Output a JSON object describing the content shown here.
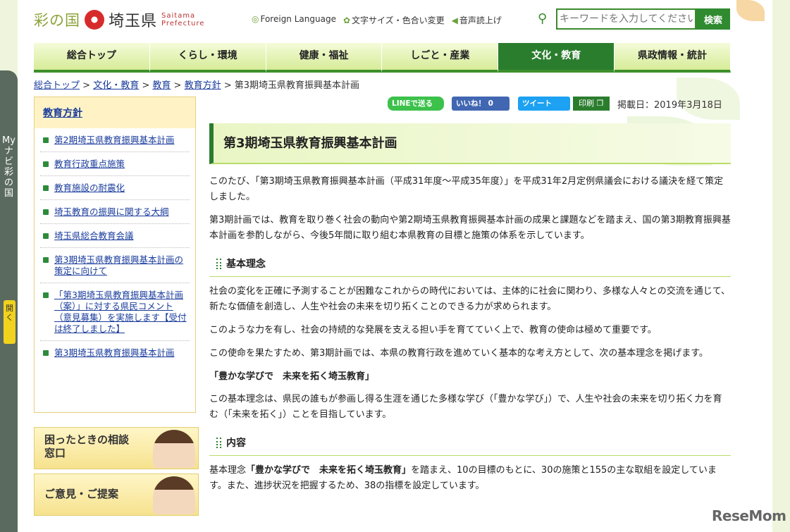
{
  "header": {
    "logo_saitama_no_kuni": "彩の国",
    "logo_pref": "埼玉県",
    "logo_en": "Saitama Prefecture",
    "util_links": [
      "Foreign Language",
      "文字サイズ・色合い変更",
      "音声読上げ"
    ],
    "search_placeholder": "キーワードを入力してください",
    "search_button": "検索"
  },
  "nav": {
    "items": [
      "総合トップ",
      "くらし・環境",
      "健康・福祉",
      "しごと・産業",
      "文化・教育",
      "県政情報・統計"
    ],
    "active": "文化・教育"
  },
  "side_tab": {
    "label": "Myナビ 彩の国",
    "open": "開く"
  },
  "breadcrumb": [
    "総合トップ",
    "文化・教育",
    "教育",
    "教育方針"
  ],
  "breadcrumb_current": "第3期埼玉県教育振興基本計画",
  "sidebar": {
    "heading": "教育方針",
    "items": [
      "第2期埼玉県教育振興基本計画",
      "教育行政重点施策",
      "教育施設の耐震化",
      "埼玉教育の振興に関する大綱",
      "埼玉県総合教育会議",
      "第3期埼玉県教育振興基本計画の策定に向けて",
      "「第3期埼玉県教育振興基本計画（案）」に対する県民コメント（意見募集）を実施します【受付は終了しました】",
      "第3期埼玉県教育振興基本計画"
    ]
  },
  "banners": [
    "困ったときの相談窓口",
    "ご意見・ご提案"
  ],
  "share": {
    "line": "LINEで送る",
    "like": "いいね！ 0",
    "tweet": "ツイート",
    "print": "印刷"
  },
  "posted": "掲載日：2019年3月18日",
  "page_title": "第3期埼玉県教育振興基本計画",
  "content": {
    "p1": "このたび、「第3期埼玉県教育振興基本計画（平成31年度～平成35年度）」を平成31年2月定例県議会における議決を経て策定しました。",
    "p2": "第3期計画では、教育を取り巻く社会の動向や第2期埼玉県教育振興基本計画の成果と課題などを踏まえ、国の第3期教育振興基本計画を参酌しながら、今後5年間に取り組む本県教育の目標と施策の体系を示しています。",
    "h_basic": "基本理念",
    "p3": "社会の変化を正確に予測することが困難なこれからの時代においては、主体的に社会に関わり、多様な人々との交流を通じて、新たな価値を創造し、人生や社会の未来を切り拓くことのできる力が求められます。",
    "p4": "このような力を有し、社会の持続的な発展を支える担い手を育てていく上で、教育の使命は極めて重要です。",
    "p5": "この使命を果たすため、第3期計画では、本県の教育行政を進めていく基本的な考え方として、次の基本理念を掲げます。",
    "motto": "「豊かな学びで　未来を拓く埼玉教育」",
    "p6": "この基本理念は、県民の誰もが参画し得る生涯を通じた多様な学び（「豊かな学び」）で、人生や社会の未来を切り拓く力を育む（「未来を拓く」）ことを目指しています。",
    "h_content": "内容",
    "p7a": "基本理念",
    "p7b": "「豊かな学びで　未来を拓く埼玉教育」",
    "p7c": "を踏まえ、10の目標のもとに、30の施策と155の主な取組を設定しています。また、進捗状況を把握するため、38の指標を設定しています。"
  },
  "watermark": "ReseMom"
}
